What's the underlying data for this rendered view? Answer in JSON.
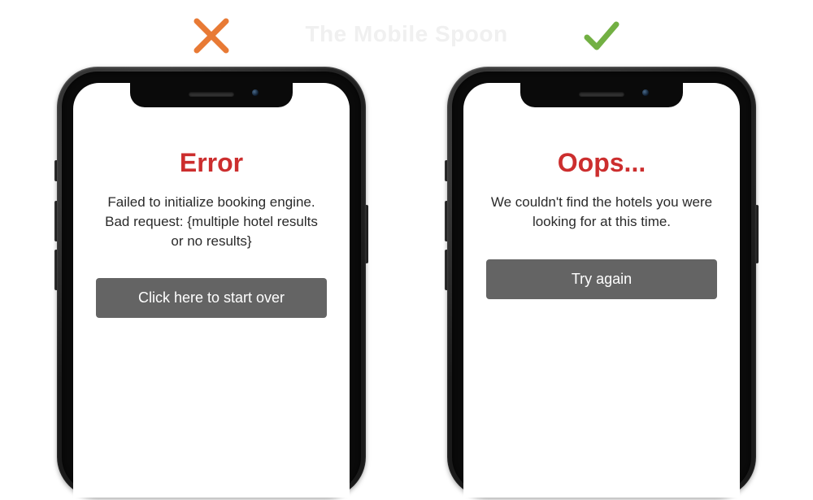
{
  "watermark": "The Mobile Spoon",
  "bad": {
    "title": "Error",
    "body": "Failed to initialize booking engine. Bad request: {multiple hotel results or no results}",
    "button": "Click here to start over"
  },
  "good": {
    "title": "Oops...",
    "body": "We couldn't find the hotels you were looking for at this time.",
    "button": "Try again"
  },
  "colors": {
    "cross": "#e87a35",
    "check": "#72b043",
    "error_title": "#cc2e2e",
    "button_bg": "#646464"
  }
}
